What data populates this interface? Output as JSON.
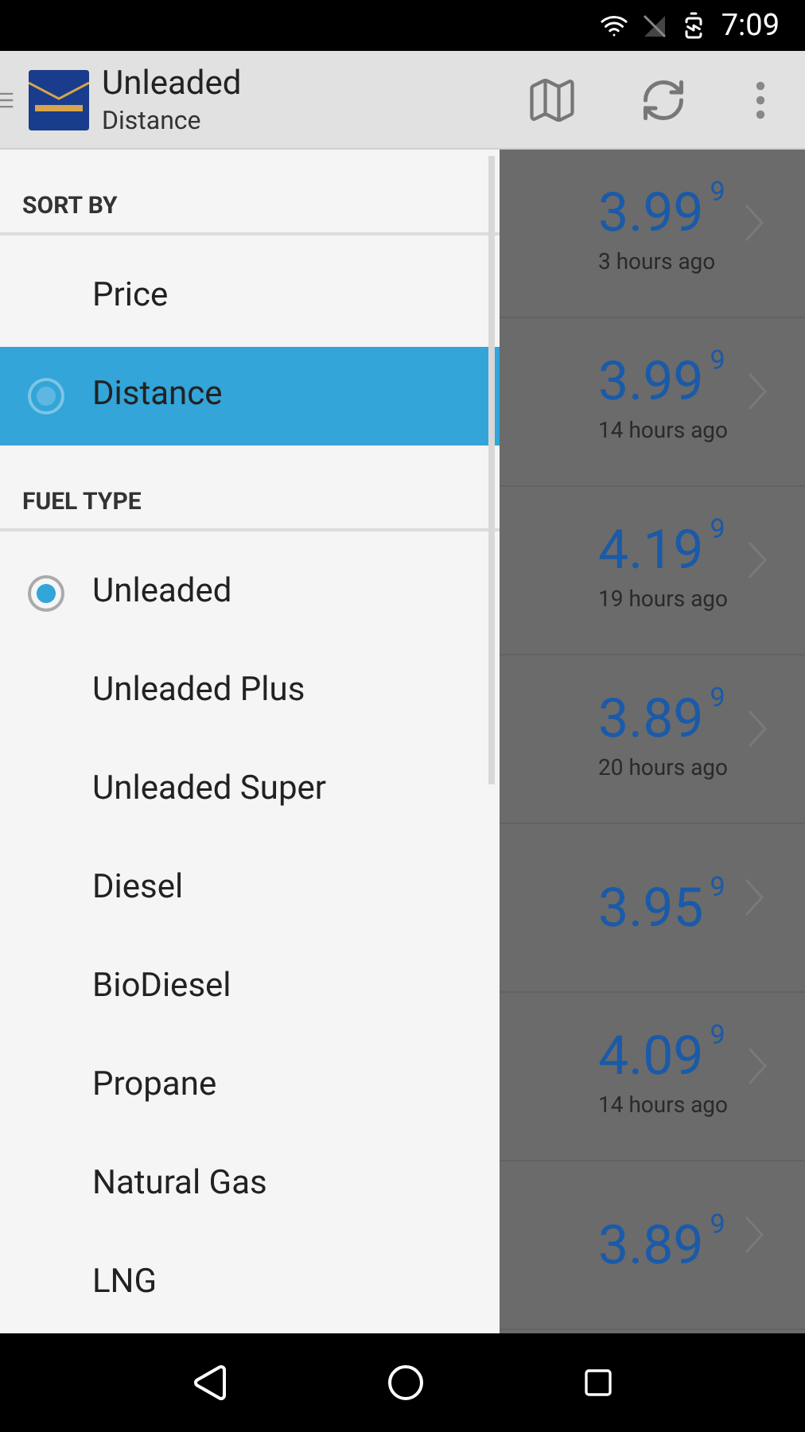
{
  "status_bar": {
    "time": "7:09"
  },
  "app_bar": {
    "title": "Unleaded",
    "subtitle": "Distance"
  },
  "drawer": {
    "sections": [
      {
        "header": "SORT BY",
        "items": [
          {
            "label": "Price",
            "selected": false
          },
          {
            "label": "Distance",
            "selected": true
          }
        ]
      },
      {
        "header": "FUEL TYPE",
        "items": [
          {
            "label": "Unleaded",
            "selected": true
          },
          {
            "label": "Unleaded Plus",
            "selected": false
          },
          {
            "label": "Unleaded Super",
            "selected": false
          },
          {
            "label": "Diesel",
            "selected": false
          },
          {
            "label": "BioDiesel",
            "selected": false
          },
          {
            "label": "Propane",
            "selected": false
          },
          {
            "label": "Natural Gas",
            "selected": false
          },
          {
            "label": "LNG",
            "selected": false
          }
        ]
      }
    ]
  },
  "prices": [
    {
      "price": "3.99$^{9}$",
      "updated": "3 hours ago"
    },
    {
      "price": "3.99$^{9}$",
      "updated": "14 hours ago"
    },
    {
      "price": "4.19$^{9}$",
      "updated": "19 hours ago"
    },
    {
      "price": "3.89$^{9}$",
      "updated": "20 hours ago"
    },
    {
      "price": "3.95$^{9}$"
    },
    {
      "price": "4.09$^{9}$",
      "updated": "14 hours ago"
    },
    {
      "price": "3.89$^{9}$"
    }
  ]
}
